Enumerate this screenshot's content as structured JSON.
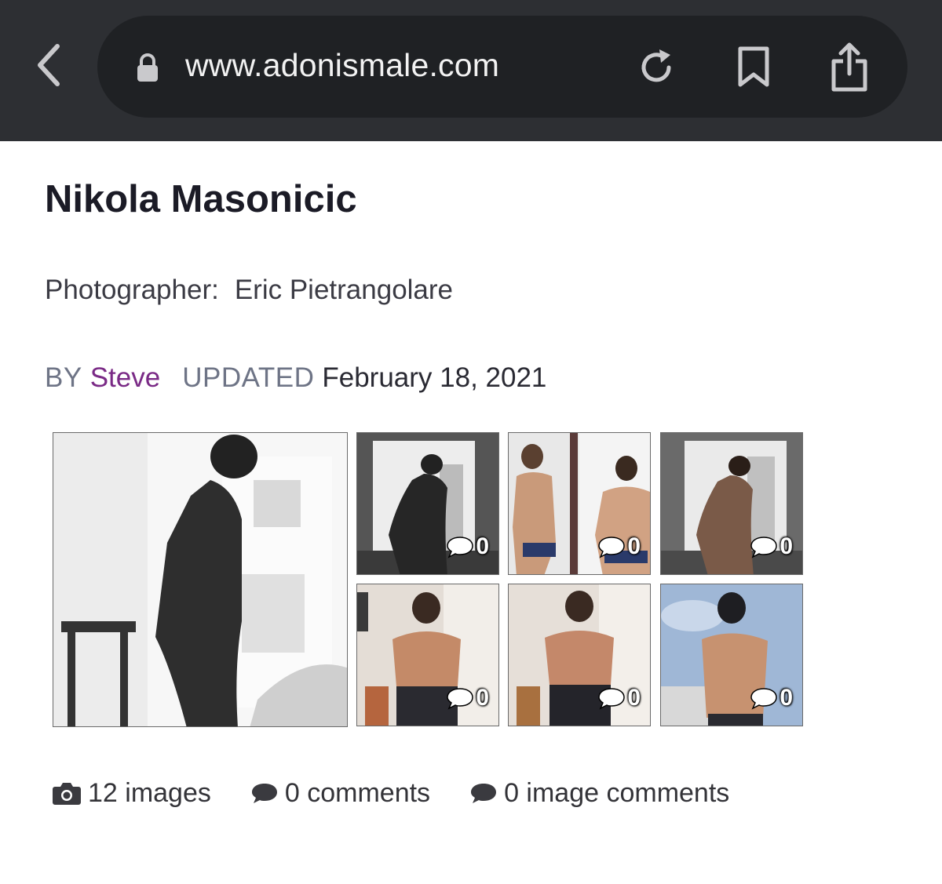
{
  "browser": {
    "url": "www.adonismale.com"
  },
  "post": {
    "title": "Nikola Masonicic",
    "photographer_label": "Photographer:",
    "photographer_name": "Eric Pietrangolare",
    "by_label": "BY",
    "author": "Steve",
    "updated_label": "UPDATED",
    "updated_date": "February 18, 2021"
  },
  "gallery": {
    "thumb_comment_counts": [
      "0",
      "0",
      "0",
      "0",
      "0",
      "0"
    ]
  },
  "stats": {
    "images": "12 images",
    "comments": "0 comments",
    "image_comments": "0 image comments"
  },
  "colors": {
    "chrome_bg": "#2d2f33",
    "url_bar_bg": "#1f2124",
    "author_link": "#7a2a86",
    "meta_label": "#6e7486"
  },
  "icons": {
    "back": "chevron-left-icon",
    "lock": "lock-icon",
    "reload": "reload-icon",
    "bookmark": "bookmark-icon",
    "share": "share-icon",
    "comment": "comment-bubble-icon",
    "camera": "camera-icon"
  }
}
